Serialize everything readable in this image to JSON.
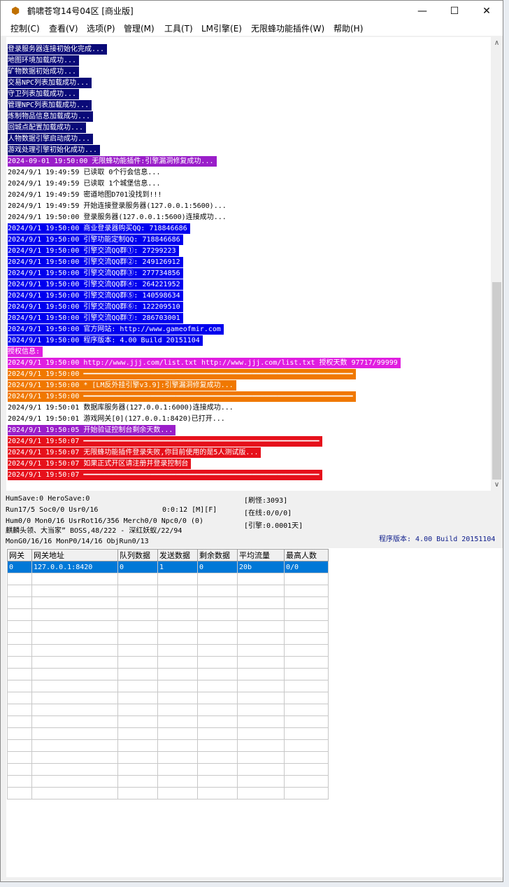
{
  "window": {
    "title": "鹤啸苍穹14号04区 [商业版]"
  },
  "menu": [
    "控制(C)",
    "查看(V)",
    "选项(P)",
    "管理(M)",
    "工具(T)",
    "LM引擎(E)",
    "无限蜂功能插件(W)",
    "帮助(H)"
  ],
  "colors": {
    "purple": "#9a1ec9",
    "blue": "#0000ee",
    "magenta": "#e01ee0",
    "orange": "#f07800",
    "red": "#e6101b",
    "selection": "#0078d7"
  },
  "log": [
    {
      "text": "登录服务器连接初始化完成...",
      "style": "navy"
    },
    {
      "text": "地图环境加载成功...",
      "style": "navy"
    },
    {
      "text": "矿物数据初始成功...",
      "style": "navy"
    },
    {
      "text": "交易NPC列表加载成功...",
      "style": "navy"
    },
    {
      "text": "守卫列表加载成功...",
      "style": "navy"
    },
    {
      "text": "管理NPC列表加载成功...",
      "style": "navy"
    },
    {
      "text": "炼制物品信息加载成功...",
      "style": "navy"
    },
    {
      "text": "回城点配置加载成功...",
      "style": "navy"
    },
    {
      "text": "人物数据引擎启动成功...",
      "style": "navy"
    },
    {
      "text": "游戏处理引擎初始化成功...",
      "style": "navy"
    },
    {
      "text": "2024-09-01 19:50:00 无限蜂功能插件:引擎漏洞修复成功...",
      "style": "purple"
    },
    {
      "text": "2024/9/1 19:49:59 已读取 0个行会信息...",
      "style": "plain"
    },
    {
      "text": "2024/9/1 19:49:59 已读取 1个城堡信息...",
      "style": "plain"
    },
    {
      "text": "2024/9/1 19:49:59 密道地图D701没找到!!!",
      "style": "plain"
    },
    {
      "text": "2024/9/1 19:49:59 开始连接登录服务器(127.0.0.1:5600)...",
      "style": "plain"
    },
    {
      "text": "2024/9/1 19:50:00 登录服务器(127.0.0.1:5600)连接成功...",
      "style": "plain"
    },
    {
      "text": "2024/9/1 19:50:00 商业登录器购买QQ: 718846686",
      "style": "blue"
    },
    {
      "text": "2024/9/1 19:50:00 引擎功能定制QQ: 718846686",
      "style": "blue"
    },
    {
      "text": "2024/9/1 19:50:00 引擎交流QQ群①: 27299223",
      "style": "blue"
    },
    {
      "text": "2024/9/1 19:50:00 引擎交流QQ群②: 249126912",
      "style": "blue"
    },
    {
      "text": "2024/9/1 19:50:00 引擎交流QQ群③: 277734856",
      "style": "blue"
    },
    {
      "text": "2024/9/1 19:50:00 引擎交流QQ群④: 264221952",
      "style": "blue"
    },
    {
      "text": "2024/9/1 19:50:00 引擎交流QQ群⑤: 140598634",
      "style": "blue"
    },
    {
      "text": "2024/9/1 19:50:00 引擎交流QQ群⑥: 122209510",
      "style": "blue"
    },
    {
      "text": "2024/9/1 19:50:00 引擎交流QQ群⑦: 286703001",
      "style": "blue"
    },
    {
      "text": "2024/9/1 19:50:00 官方网站: http://www.gameofmir.com",
      "style": "blue"
    },
    {
      "text": "2024/9/1 19:50:00 程序版本: 4.00 Build 20151104",
      "style": "blue"
    },
    {
      "text": "授权信息:",
      "style": "magenta"
    },
    {
      "text": "2024/9/1 19:50:00 http://www.jjj.com/list.txt http://www.jjj.com/list.txt 授权天数 97717/99999",
      "style": "magenta"
    },
    {
      "text": "2024/9/1 19:50:00 ━━━━━━━━━━━━━━━━━━━━━━━━━━━━━━━━━━━━━━━━━━━━━━━━━━━━━━━━━━━━━━━━",
      "style": "orange"
    },
    {
      "text": "2024/9/1 19:50:00 * [LM反外挂引擎v3.9]:引擎漏洞修复成功...",
      "style": "orange"
    },
    {
      "text": "2024/9/1 19:50:00 ━━━━━━━━━━━━━━━━━━━━━━━━━━━━━━━━━━━━━━━━━━━━━━━━━━━━━━━━━━━━━━━━",
      "style": "orange"
    },
    {
      "text": "2024/9/1 19:50:01 数据库服务器(127.0.0.1:6000)连接成功...",
      "style": "plain"
    },
    {
      "text": "2024/9/1 19:50:01 游戏网关[0](127.0.0.1:8420)已打开...",
      "style": "plain"
    },
    {
      "text": "2024/9/1 19:50:05 开始验证控制台剩余天数...",
      "style": "purple"
    },
    {
      "text": "2024/9/1 19:50:07 ━━━━━━━━━━━━━━━━━━━━━━━━━━━━━━━━━━━━━━━━━━━━━━━━━━━━━━━━",
      "style": "red"
    },
    {
      "text": "2024/9/1 19:50:07 无限蜂功能插件登录失败,你目前使用的是5人测试版...",
      "style": "red"
    },
    {
      "text": "2024/9/1 19:50:07 如果正式开区请注册并登录控制台",
      "style": "red"
    },
    {
      "text": "2024/9/1 19:50:07 ━━━━━━━━━━━━━━━━━━━━━━━━━━━━━━━━━━━━━━━━━━━━━━━━━━━━━━━━",
      "style": "red"
    }
  ],
  "status": {
    "line1": "HumSave:0 HeroSave:0",
    "line2": "Run17/5 Soc0/0 Usr0/16",
    "runtime": "0:0:12 [M][F]",
    "line3": "Hum0/0 Mon0/16 UsrRot16/356 Merch0/0 Npc0/0 (0)",
    "line4": "麒麟头领、大当家” BOSS,48/222 - 深红妖蚁/22/94",
    "line5": "MonG0/16/16 MonP0/14/16 ObjRun0/13",
    "monsters": "[刷怪:3093]",
    "online": "[在线:0/0/0]",
    "engine": "[引擎:0.0001天]",
    "version": "程序版本: 4.00 Build 20151104"
  },
  "grid": {
    "headers": [
      "网关",
      "网关地址",
      "队列数据",
      "发送数据",
      "剩余数据",
      "平均流量",
      "最高人数"
    ],
    "rows": [
      [
        "0",
        "127.0.0.1:8420",
        "0",
        "1",
        "0",
        "20b",
        "0/0"
      ]
    ]
  }
}
